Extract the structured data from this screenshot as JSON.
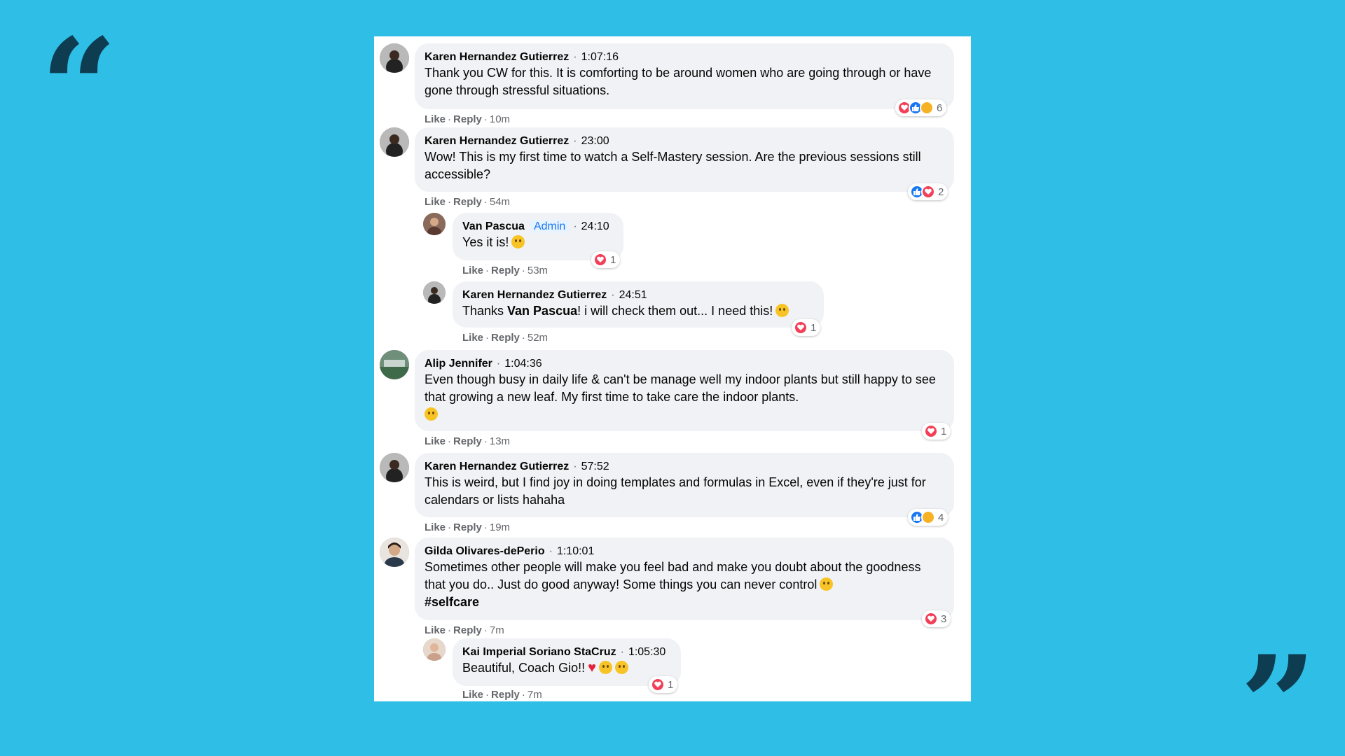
{
  "decor": {
    "open_quote": "“",
    "close_quote": "”"
  },
  "comments": [
    {
      "author": "Karen Hernandez Gutierrez",
      "time": "1:07:16",
      "text": "Thank you CW for this. It is comforting to be around women who are going through or have gone through stressful situations.",
      "like": "Like",
      "reply": "Reply",
      "age": "10m",
      "reactions": {
        "types": [
          "love",
          "like",
          "care"
        ],
        "count": "6"
      }
    },
    {
      "author": "Karen Hernandez Gutierrez",
      "time": "23:00",
      "text": "Wow! This is my first time to watch a Self-Mastery session. Are the previous sessions still accessible?",
      "like": "Like",
      "reply": "Reply",
      "age": "54m",
      "reactions": {
        "types": [
          "like",
          "love"
        ],
        "count": "2"
      }
    },
    {
      "author": "Van Pascua",
      "badge": "Admin",
      "time": "24:10",
      "text": "Yes it is!",
      "like": "Like",
      "reply": "Reply",
      "age": "53m",
      "reactions": {
        "types": [
          "love"
        ],
        "count": "1"
      }
    },
    {
      "author": "Karen Hernandez Gutierrez",
      "time": "24:51",
      "text_pre": "Thanks ",
      "mention": "Van Pascua",
      "text_post": "! i will check them out... I need this!",
      "like": "Like",
      "reply": "Reply",
      "age": "52m",
      "reactions": {
        "types": [
          "love"
        ],
        "count": "1"
      }
    },
    {
      "author": "Alip Jennifer",
      "time": "1:04:36",
      "text": "Even though busy in daily life & can't be manage well my indoor plants but still happy to see that growing a new leaf. My first time to take care the indoor plants.",
      "like": "Like",
      "reply": "Reply",
      "age": "13m",
      "reactions": {
        "types": [
          "love"
        ],
        "count": "1"
      }
    },
    {
      "author": "Karen Hernandez Gutierrez",
      "time": "57:52",
      "text": "This is weird, but I find joy in doing templates and formulas in Excel, even if they're just for calendars or lists hahaha",
      "like": "Like",
      "reply": "Reply",
      "age": "19m",
      "reactions": {
        "types": [
          "like",
          "wow"
        ],
        "count": "4"
      }
    },
    {
      "author": "Gilda Olivares-dePerio",
      "time": "1:10:01",
      "text": "Sometimes other people will make you feel bad and make you doubt about the goodness that you do.. Just do good anyway! Some things you can never control",
      "hashtag": "#selfcare",
      "like": "Like",
      "reply": "Reply",
      "age": "7m",
      "reactions": {
        "types": [
          "love"
        ],
        "count": "3"
      }
    },
    {
      "author": "Kai Imperial Soriano StaCruz",
      "time": "1:05:30",
      "text": "Beautiful, Coach Gio!!",
      "like": "Like",
      "reply": "Reply",
      "age": "7m",
      "reactions": {
        "types": [
          "love"
        ],
        "count": "1"
      }
    }
  ],
  "colors": {
    "background": "#2fbfe6",
    "quote": "#0e3d52",
    "love": "#f33e58",
    "like": "#1877f2",
    "admin": "#1877f2"
  }
}
